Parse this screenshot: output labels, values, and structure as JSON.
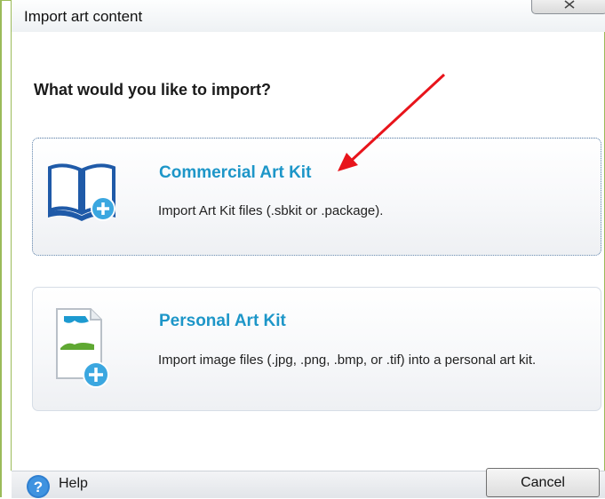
{
  "window": {
    "title": "Import art content",
    "close_icon": "close-icon"
  },
  "main": {
    "heading": "What would you like to import?"
  },
  "options": [
    {
      "title": "Commercial Art Kit",
      "description": "Import Art Kit files (.sbkit or .package).",
      "icon": "book-add-icon",
      "focused": true
    },
    {
      "title": "Personal Art Kit",
      "description": "Import image files (.jpg, .png, .bmp, or .tif) into a personal art kit.",
      "icon": "image-file-add-icon",
      "focused": false
    }
  ],
  "annotation": {
    "arrow_color": "#e8141b",
    "icon": "red-arrow-annotation"
  },
  "footer": {
    "help_label": "Help",
    "help_icon": "help-icon",
    "cancel_label": "Cancel"
  },
  "colors": {
    "accent": "#1d96c8",
    "frame_border": "#9bbb59",
    "plus_badge": "#3ba7e0"
  }
}
